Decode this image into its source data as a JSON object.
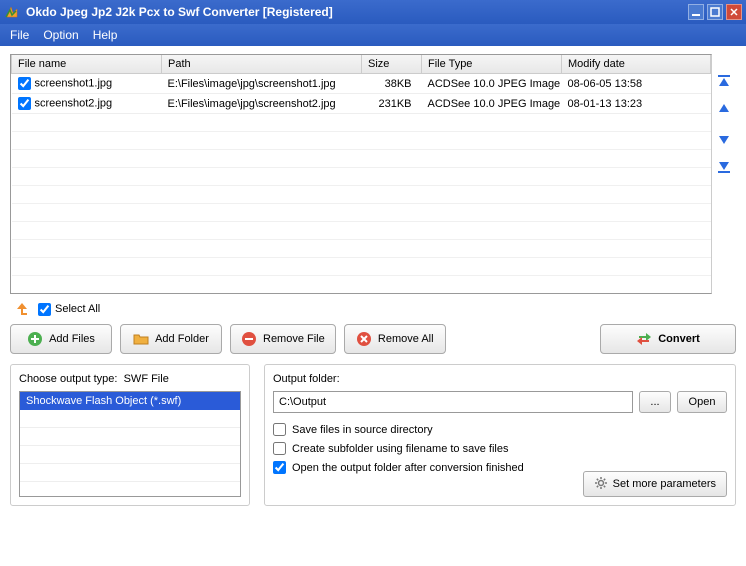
{
  "window": {
    "title": "Okdo Jpeg Jp2 J2k Pcx to Swf Converter [Registered]"
  },
  "menu": {
    "file": "File",
    "option": "Option",
    "help": "Help"
  },
  "columns": {
    "name": "File name",
    "path": "Path",
    "size": "Size",
    "type": "File Type",
    "date": "Modify date"
  },
  "files": [
    {
      "name": "screenshot1.jpg",
      "path": "E:\\Files\\image\\jpg\\screenshot1.jpg",
      "size": "38KB",
      "type": "ACDSee 10.0 JPEG Image",
      "date": "08-06-05 13:58",
      "checked": true
    },
    {
      "name": "screenshot2.jpg",
      "path": "E:\\Files\\image\\jpg\\screenshot2.jpg",
      "size": "231KB",
      "type": "ACDSee 10.0 JPEG Image",
      "date": "08-01-13 13:23",
      "checked": true
    }
  ],
  "selectAll": {
    "label": "Select All",
    "checked": true
  },
  "buttons": {
    "addFiles": "Add Files",
    "addFolder": "Add Folder",
    "removeFile": "Remove File",
    "removeAll": "Remove All",
    "convert": "Convert"
  },
  "outputType": {
    "label_prefix": "Choose output type:",
    "label_value": "SWF File",
    "selected": "Shockwave Flash Object (*.swf)"
  },
  "outputFolder": {
    "label": "Output folder:",
    "value": "C:\\Output",
    "browse": "...",
    "open": "Open",
    "saveInSource": {
      "label": "Save files in source directory",
      "checked": false
    },
    "createSubfolder": {
      "label": "Create subfolder using filename to save files",
      "checked": false
    },
    "openAfter": {
      "label": "Open the output folder after conversion finished",
      "checked": true
    },
    "moreParams": "Set more parameters"
  }
}
